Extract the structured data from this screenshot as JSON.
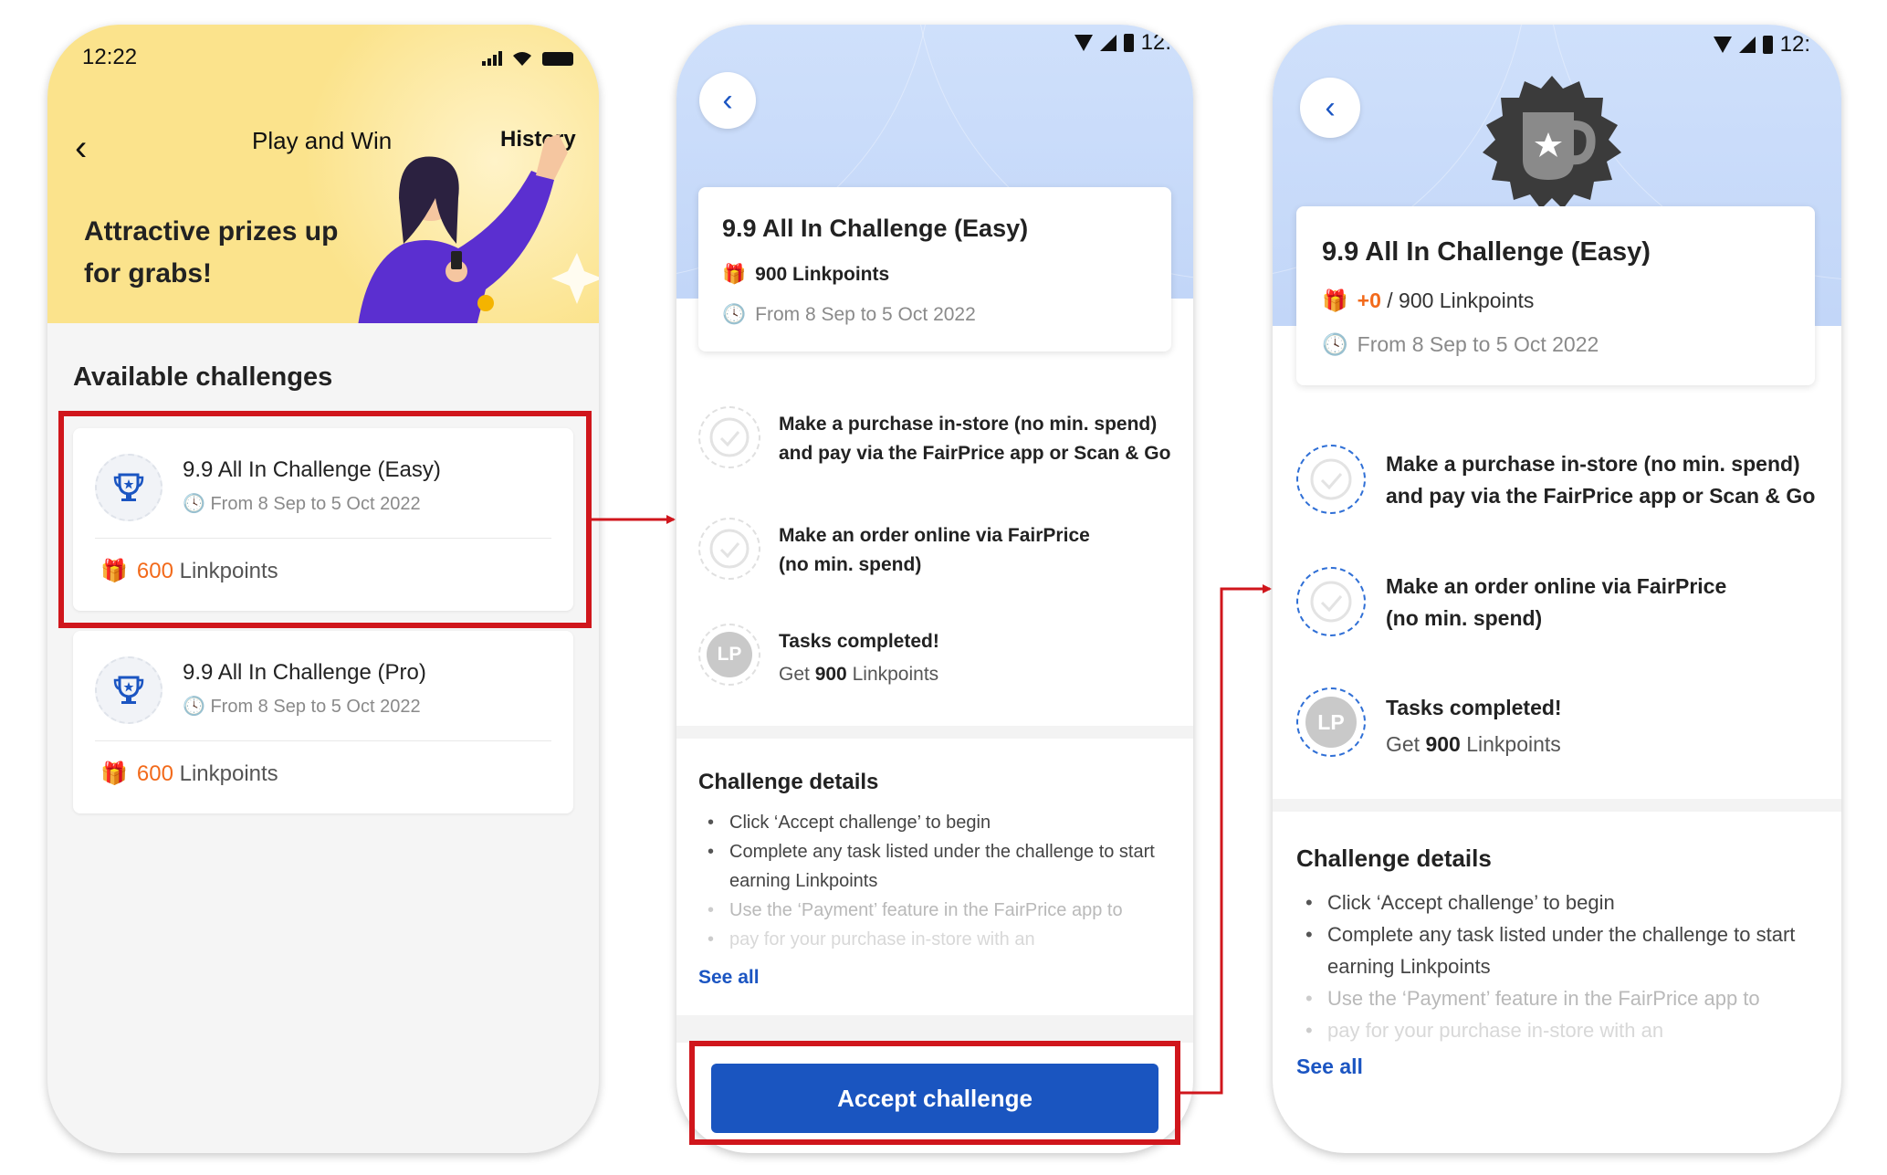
{
  "colors": {
    "accent_blue": "#1a55c0",
    "points_orange": "#f26a1b",
    "highlight_red": "#d0161c",
    "header_yellow": "#fbe38c",
    "header_blue": "#c8dbf9"
  },
  "screen1": {
    "status_time": "12:22",
    "title": "Play and Win",
    "history_label": "History",
    "promo": "Attractive prizes up for grabs!",
    "section_title": "Available challenges",
    "challenges": [
      {
        "title": "9.9 All In Challenge (Easy)",
        "date": "From 8 Sep to 5 Oct 2022",
        "points": "600",
        "points_label": "Linkpoints"
      },
      {
        "title": "9.9 All In Challenge (Pro)",
        "date": "From 8 Sep to 5 Oct 2022",
        "points": "600",
        "points_label": "Linkpoints"
      }
    ]
  },
  "screen2": {
    "status_time": "12:",
    "card": {
      "title": "9.9 All In Challenge (Easy)",
      "points": "900 Linkpoints",
      "date": "From 8 Sep to 5 Oct 2022"
    },
    "tasks": [
      {
        "line1": "Make a purchase in-store (no min. spend)",
        "line2": "and pay via the FairPrice app or Scan & Go"
      },
      {
        "line1": "Make an order online via FairPrice",
        "line2": "(no min. spend)"
      }
    ],
    "completed": {
      "title": "Tasks completed!",
      "prefix": "Get",
      "points": "900",
      "suffix": "Linkpoints",
      "badge": "LP"
    },
    "details_title": "Challenge details",
    "details": [
      "Click ‘Accept challenge’ to begin",
      "Complete any task listed under the challenge to start earning Linkpoints",
      "Use the ‘Payment’ feature in the FairPrice app to",
      "pay for your purchase in-store with an"
    ],
    "see_all": "See all",
    "accept_button": "Accept challenge"
  },
  "screen3": {
    "status_time": "12:",
    "card": {
      "title": "9.9 All In Challenge (Easy)",
      "earned": "+0",
      "points_total": "/ 900 Linkpoints",
      "date": "From 8 Sep to 5 Oct 2022"
    },
    "tasks": [
      {
        "line1": "Make a purchase in-store (no min. spend)",
        "line2": "and pay via the FairPrice app or Scan & Go"
      },
      {
        "line1": "Make an order online via FairPrice",
        "line2": "(no min. spend)"
      }
    ],
    "completed": {
      "title": "Tasks completed!",
      "prefix": "Get",
      "points": "900",
      "suffix": "Linkpoints",
      "badge": "LP"
    },
    "details_title": "Challenge details",
    "details": [
      "Click ‘Accept challenge’ to begin",
      "Complete any task listed under the challenge to start earning Linkpoints",
      "Use the ‘Payment’ feature in the FairPrice app to",
      "pay for your purchase in-store with an"
    ],
    "see_all": "See all"
  }
}
